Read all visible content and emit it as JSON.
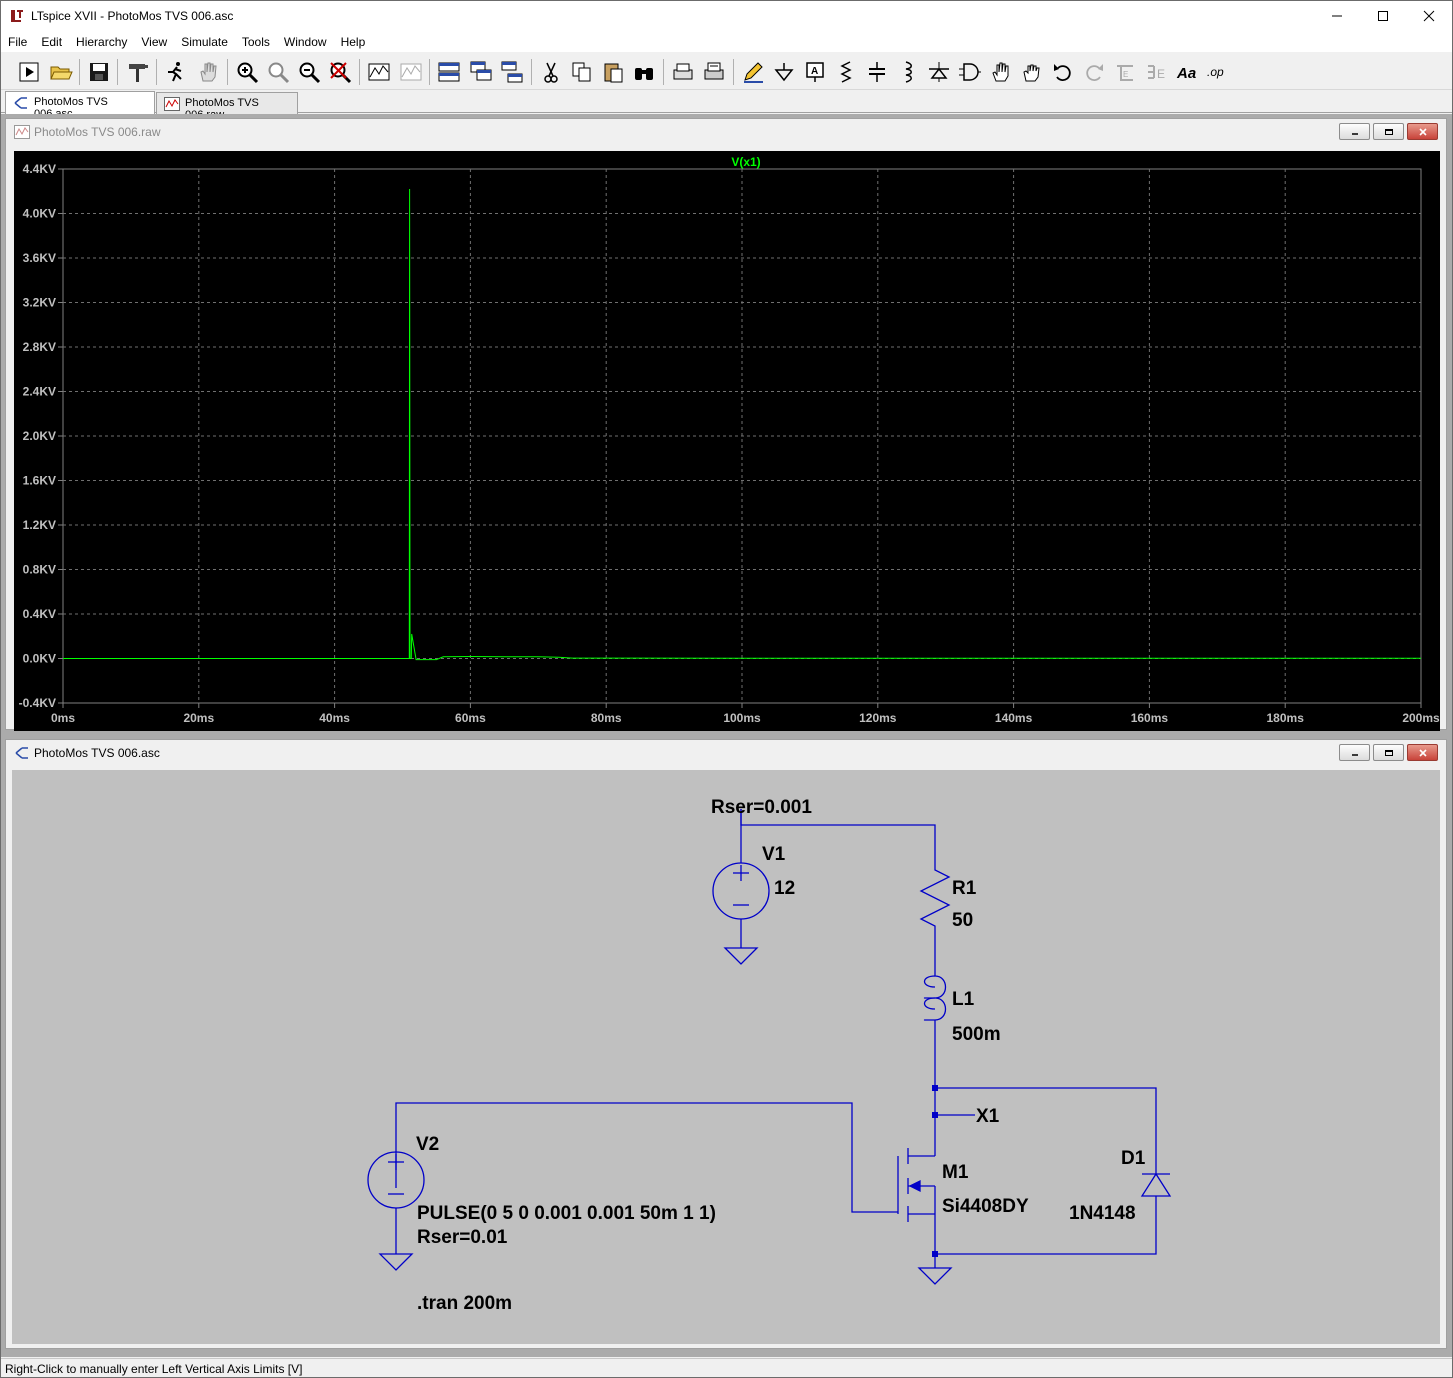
{
  "window": {
    "title": "LTspice XVII - PhotoMos TVS 006.asc"
  },
  "menu": [
    "File",
    "Edit",
    "Hierarchy",
    "View",
    "Simulate",
    "Tools",
    "Window",
    "Help"
  ],
  "tabs": [
    {
      "label": "PhotoMos TVS 006.asc",
      "active": true
    },
    {
      "label": "PhotoMos TVS 006.raw",
      "active": false
    }
  ],
  "plot_window": {
    "title": "PhotoMos TVS 006.raw"
  },
  "schematic_window": {
    "title": "PhotoMos TVS 006.asc"
  },
  "chart_data": {
    "type": "line",
    "title": "V(x1)",
    "xlabel": "",
    "ylabel": "",
    "x_ticks": [
      "0ms",
      "20ms",
      "40ms",
      "60ms",
      "80ms",
      "100ms",
      "120ms",
      "140ms",
      "160ms",
      "180ms",
      "200ms"
    ],
    "y_ticks": [
      "4.4KV",
      "4.0KV",
      "3.6KV",
      "3.2KV",
      "2.8KV",
      "2.4KV",
      "2.0KV",
      "1.6KV",
      "1.2KV",
      "0.8KV",
      "0.4KV",
      "0.0KV",
      "-0.4KV"
    ],
    "xlim": [
      0,
      200
    ],
    "ylim": [
      -0.4,
      4.4
    ],
    "x_unit": "ms",
    "y_unit": "KV",
    "grid": true,
    "series": [
      {
        "name": "V(x1)",
        "color": "#00ff00",
        "x": [
          0,
          51.0,
          51.05,
          51.1,
          51.3,
          51.35,
          52,
          55,
          56,
          60,
          65,
          70,
          73,
          75,
          100,
          150,
          200
        ],
        "y": [
          0.0,
          0.0,
          4.22,
          0.0,
          0.0,
          0.22,
          -0.01,
          -0.01,
          0.015,
          0.018,
          0.016,
          0.015,
          0.012,
          0.004,
          0.002,
          0.002,
          0.002
        ]
      }
    ]
  },
  "schematic": {
    "wire_color": "#0000c8",
    "labels": {
      "v1_rser": "Rser=0.001",
      "v1_name": "V1",
      "v1_value": "12",
      "r1_name": "R1",
      "r1_value": "50",
      "l1_name": "L1",
      "l1_value": "500m",
      "net_x1": "X1",
      "m1_name": "M1",
      "m1_value": "Si4408DY",
      "d1_name": "D1",
      "d1_value": "1N4148",
      "v2_name": "V2",
      "v2_value": "PULSE(0 5 0 0.001 0.001 50m 1 1)",
      "v2_rser": "Rser=0.01",
      "directive": ".tran 200m"
    }
  },
  "status": {
    "text": "Right-Click to manually enter Left Vertical Axis Limits [V]"
  }
}
